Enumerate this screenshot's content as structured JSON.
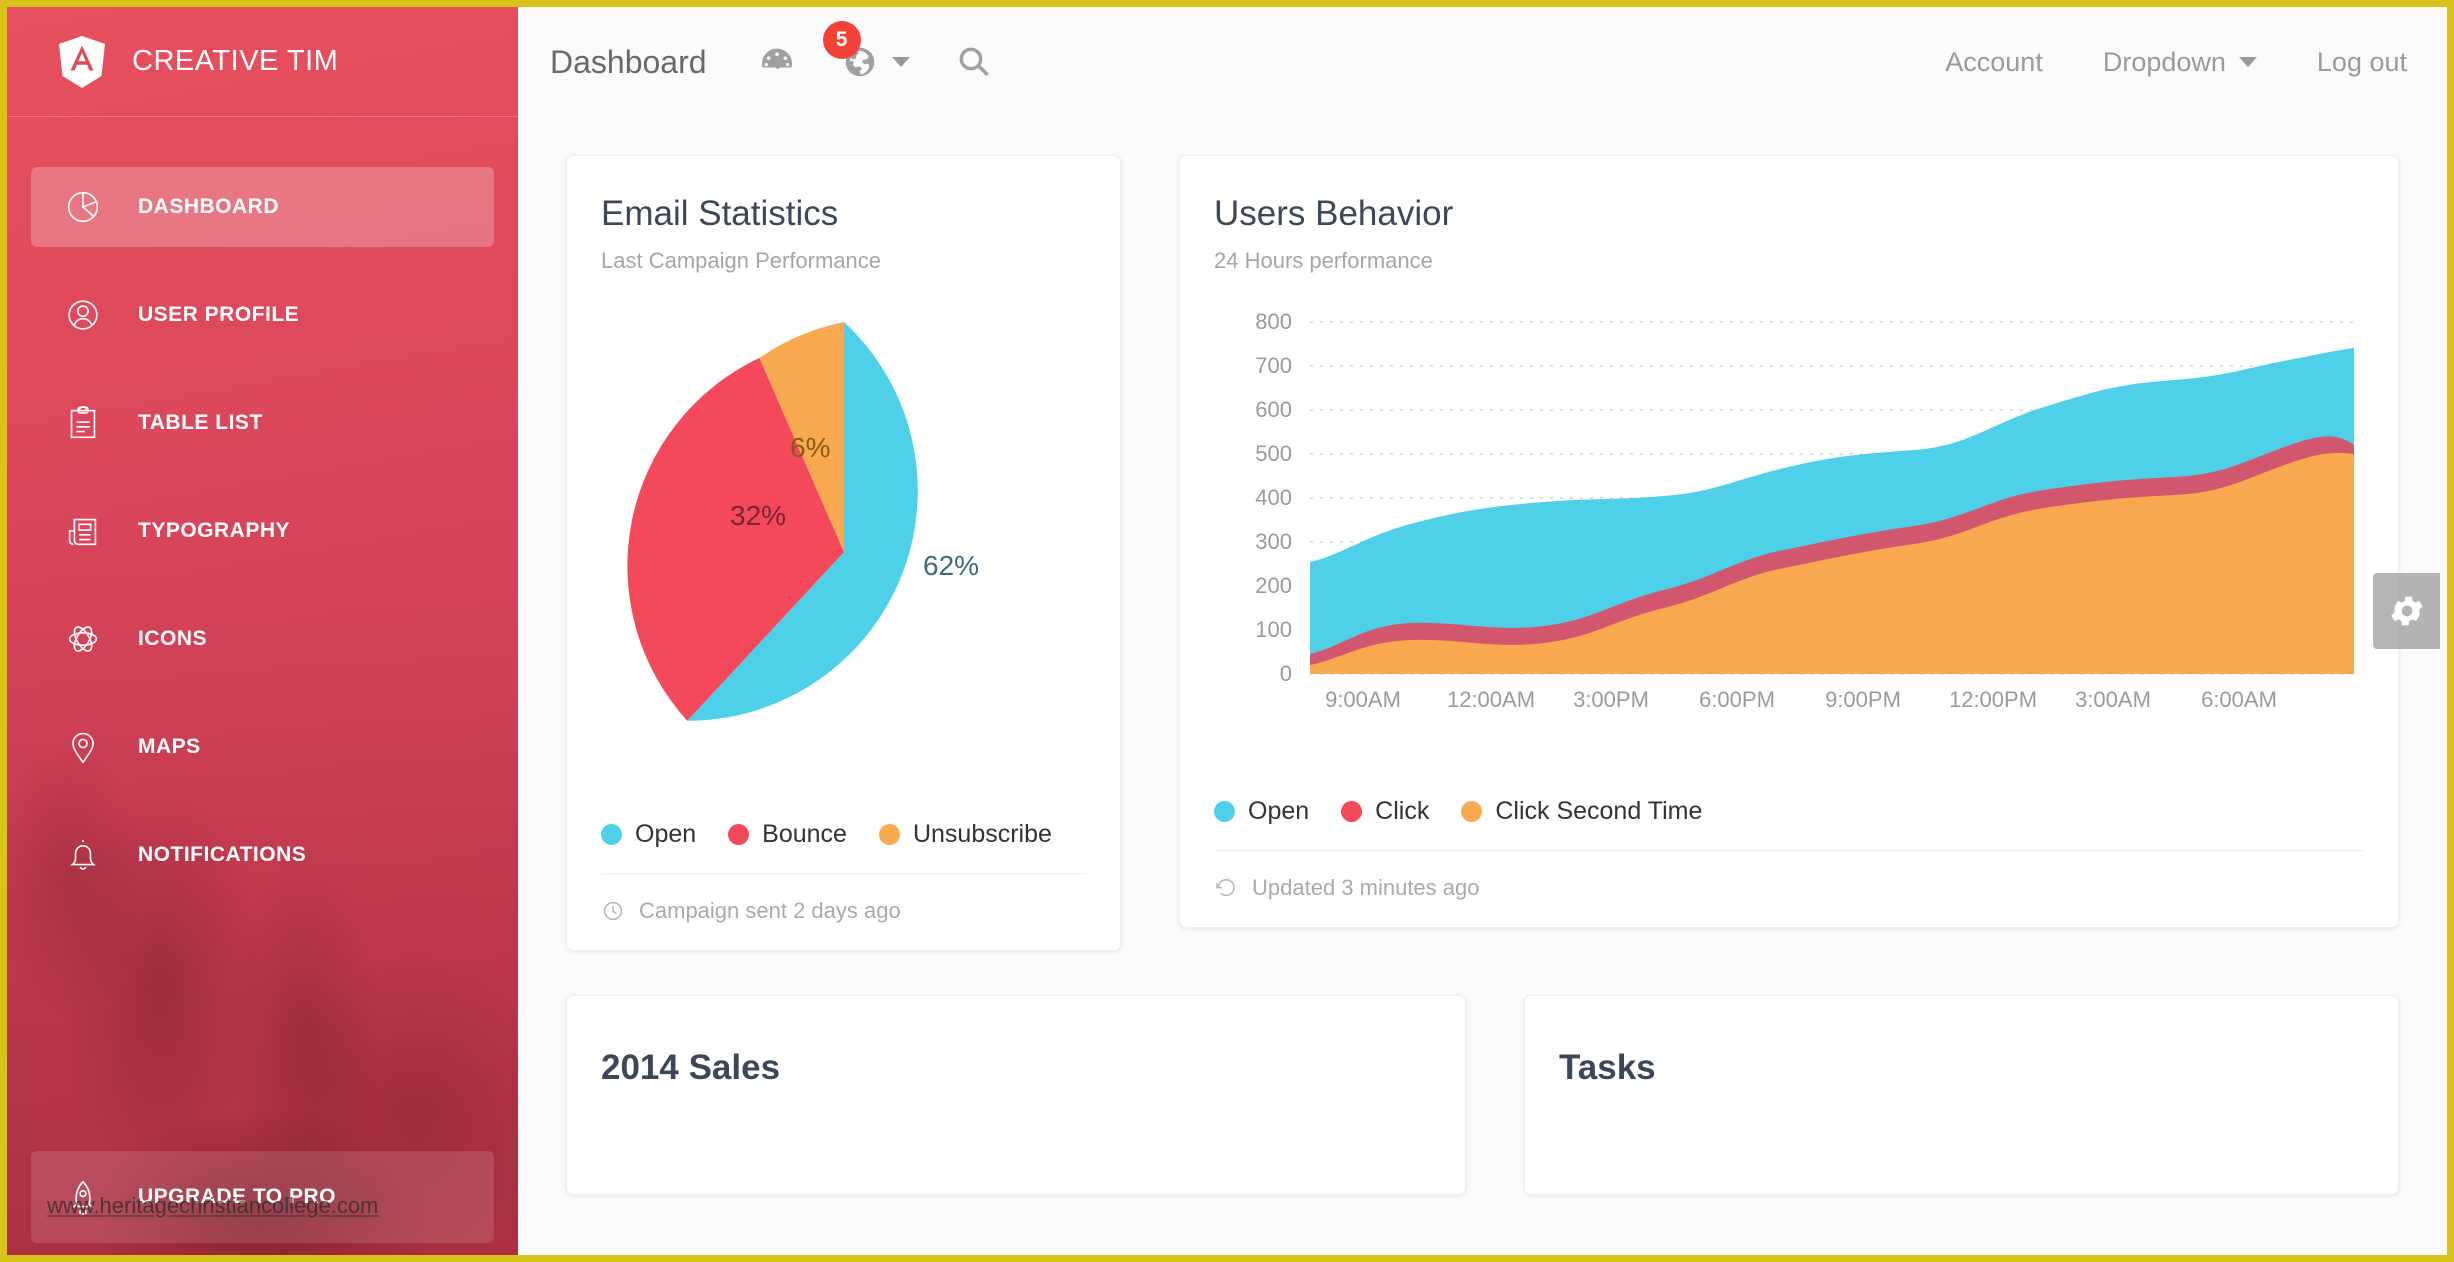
{
  "brand": {
    "name": "CREATIVE TIM",
    "logo_icon": "angular-shield-icon"
  },
  "sidebar": {
    "items": [
      {
        "label": "DASHBOARD",
        "icon": "pie-chart-icon",
        "active": true
      },
      {
        "label": "USER PROFILE",
        "icon": "user-circle-icon",
        "active": false
      },
      {
        "label": "TABLE LIST",
        "icon": "clipboard-icon",
        "active": false
      },
      {
        "label": "TYPOGRAPHY",
        "icon": "newspaper-icon",
        "active": false
      },
      {
        "label": "ICONS",
        "icon": "atom-icon",
        "active": false
      },
      {
        "label": "MAPS",
        "icon": "map-pin-icon",
        "active": false
      },
      {
        "label": "NOTIFICATIONS",
        "icon": "bell-icon",
        "active": false
      }
    ],
    "upgrade": {
      "label": "UPGRADE TO PRO",
      "icon": "rocket-icon"
    }
  },
  "watermark": "www.heritagechristiancollege.com",
  "navbar": {
    "title": "Dashboard",
    "icons": [
      {
        "name": "dashboard-gauge-icon"
      },
      {
        "name": "globe-icon",
        "badge": "5",
        "has_caret": true
      },
      {
        "name": "search-icon"
      }
    ],
    "links": [
      {
        "label": "Account",
        "has_caret": false
      },
      {
        "label": "Dropdown",
        "has_caret": true
      },
      {
        "label": "Log out",
        "has_caret": false
      }
    ]
  },
  "colors": {
    "brand_red": "#e8505d",
    "border_yellow": "#d8c31b",
    "cyan": "#4dd0e8",
    "red": "#f4495a",
    "orange": "#f9a94f",
    "rose": "#d2566e",
    "badge_red": "#f44336"
  },
  "cards": {
    "email": {
      "title": "Email Statistics",
      "subtitle": "Last Campaign Performance",
      "footer_icon": "clock-icon",
      "footer": "Campaign sent 2 days ago",
      "legend": [
        {
          "label": "Open",
          "color": "#4dd0e8"
        },
        {
          "label": "Bounce",
          "color": "#f4495a"
        },
        {
          "label": "Unsubscribe",
          "color": "#f9a94f"
        }
      ]
    },
    "behavior": {
      "title": "Users Behavior",
      "subtitle": "24 Hours performance",
      "footer_icon": "refresh-history-icon",
      "footer": "Updated 3 minutes ago",
      "legend": [
        {
          "label": "Open",
          "color": "#4dd0e8"
        },
        {
          "label": "Click",
          "color": "#f4495a"
        },
        {
          "label": "Click Second Time",
          "color": "#f9a94f"
        }
      ]
    },
    "sales": {
      "title": "2014 Sales"
    },
    "tasks": {
      "title": "Tasks"
    }
  },
  "settings_button": {
    "icon": "gear-icon"
  },
  "chart_data": [
    {
      "type": "pie",
      "title": "Email Statistics",
      "subtitle": "Last Campaign Performance",
      "labels": [
        "Open",
        "Bounce",
        "Unsubscribe"
      ],
      "values": [
        62,
        32,
        6
      ],
      "data_labels": [
        "62%",
        "32%",
        "6%"
      ],
      "colors": [
        "#4dd0e8",
        "#f4495a",
        "#f9a94f"
      ],
      "legend_position": "bottom",
      "start_angle_deg": 0
    },
    {
      "type": "area",
      "title": "Users Behavior",
      "subtitle": "24 Hours performance",
      "stacked": true,
      "xlabel": "",
      "ylabel": "",
      "grid": true,
      "legend_position": "bottom",
      "x": [
        "9:00AM",
        "12:00AM",
        "3:00PM",
        "6:00PM",
        "9:00PM",
        "12:00PM",
        "3:00AM",
        "6:00AM"
      ],
      "ylim": [
        0,
        800
      ],
      "yticks": [
        0,
        100,
        200,
        300,
        400,
        500,
        600,
        700,
        800
      ],
      "series": [
        {
          "name": "Click Second Time",
          "color": "#f9a94f",
          "values": [
            20,
            75,
            60,
            115,
            170,
            215,
            255,
            300,
            420,
            425,
            500
          ]
        },
        {
          "name": "Click",
          "color": "#d2566e",
          "values": [
            45,
            115,
            95,
            155,
            210,
            260,
            305,
            360,
            435,
            440,
            520
          ]
        },
        {
          "name": "Open",
          "color": "#4dd0e8",
          "values": [
            255,
            345,
            390,
            465,
            470,
            520,
            560,
            605,
            675,
            680,
            730
          ]
        }
      ]
    }
  ]
}
